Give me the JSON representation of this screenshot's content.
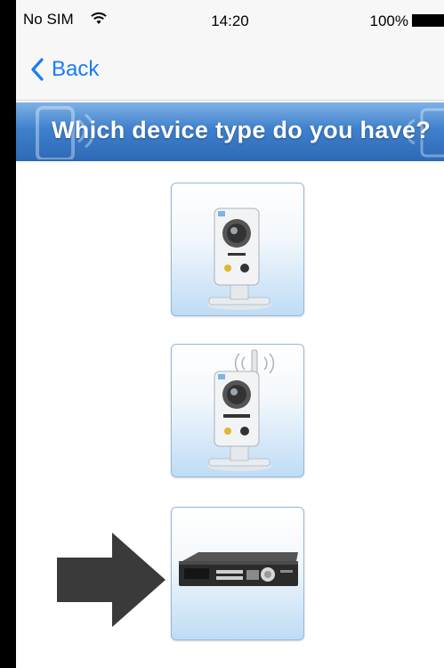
{
  "status_bar": {
    "carrier": "No SIM",
    "wifi_icon": "wifi-icon",
    "time": "14:20",
    "battery": "100%"
  },
  "nav": {
    "back_label": "Back",
    "back_icon": "chevron-left-icon"
  },
  "banner": {
    "title": "Which device type do you have?"
  },
  "devices": [
    {
      "id": "ip-camera",
      "icon": "ip-camera-icon"
    },
    {
      "id": "wireless-ip-camera",
      "icon": "wireless-ip-camera-icon"
    },
    {
      "id": "dvr",
      "icon": "dvr-icon",
      "highlighted": true
    }
  ],
  "pointer": {
    "icon": "arrow-right-icon",
    "points_to": "dvr"
  },
  "colors": {
    "accent": "#1a7cf5",
    "banner": "#3f80cc",
    "arrow": "#3a3a3a"
  }
}
